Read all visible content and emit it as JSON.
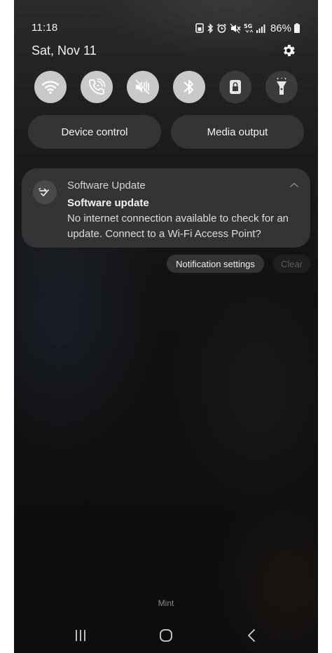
{
  "status_bar": {
    "time": "11:18",
    "battery_percent": "86%",
    "icons": [
      "save-icon",
      "bluetooth-icon",
      "alarm-icon",
      "mute-icon",
      "5g-icon",
      "signal-icon",
      "battery-icon"
    ]
  },
  "header": {
    "date": "Sat, Nov 11",
    "settings_icon": "gear-icon"
  },
  "quick_settings": {
    "tiles": [
      {
        "name": "Wi-Fi",
        "icon": "wifi-icon",
        "state": "on"
      },
      {
        "name": "Wi-Fi calling",
        "icon": "wifi-calling-icon",
        "state": "on"
      },
      {
        "name": "Vibrate",
        "icon": "vibrate-icon",
        "state": "on"
      },
      {
        "name": "Bluetooth",
        "icon": "bluetooth-icon",
        "state": "on"
      },
      {
        "name": "Screen lock",
        "icon": "lock-icon",
        "state": "off"
      },
      {
        "name": "Flashlight",
        "icon": "flashlight-icon",
        "state": "off"
      }
    ],
    "active_color": "#c9c9c9",
    "inactive_color": "#3b3b3d"
  },
  "panel_buttons": {
    "device_control": "Device control",
    "media_output": "Media output"
  },
  "notification": {
    "app_icon": "sync-update-icon",
    "app_name": "Software Update",
    "title": "Software update",
    "body": "No internet connection available to check for an update. Connect to a Wi-Fi Access Point?"
  },
  "notification_actions": {
    "settings_label": "Notification settings",
    "clear_label": "Clear"
  },
  "carrier": "Mint",
  "navigation": {
    "recents": "recents-icon",
    "home": "home-icon",
    "back": "back-icon"
  }
}
